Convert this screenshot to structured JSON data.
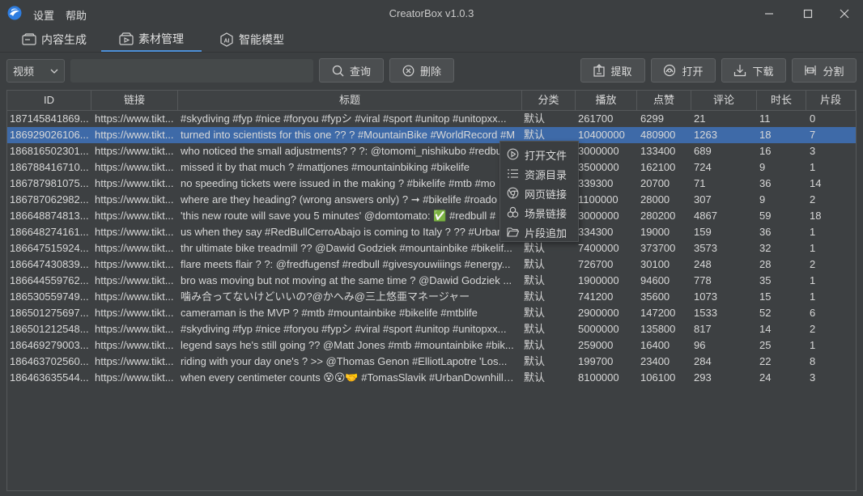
{
  "app": {
    "title": "CreatorBox v1.0.3"
  },
  "menu": {
    "settings": "设置",
    "help": "帮助"
  },
  "tabs": [
    {
      "label": "内容生成",
      "icon": "content-generate-icon"
    },
    {
      "label": "素材管理",
      "icon": "material-manage-icon",
      "active": true
    },
    {
      "label": "智能模型",
      "icon": "ai-model-icon"
    }
  ],
  "toolbar": {
    "type_select": "视频",
    "search_value": "",
    "query": "查询",
    "delete": "删除",
    "extract": "提取",
    "open": "打开",
    "download": "下载",
    "split": "分割"
  },
  "table": {
    "columns": [
      "ID",
      "链接",
      "标题",
      "分类",
      "播放",
      "点赞",
      "评论",
      "时长",
      "片段"
    ],
    "rows": [
      [
        "187145841869...",
        "https://www.tikt...",
        "#skydiving #fyp #nice #foryou #fypシ #viral #sport #unitop #unitopxx...",
        "默认",
        "261700",
        "6299",
        "21",
        "11",
        "0"
      ],
      [
        "186929026106...",
        "https://www.tikt...",
        "turned into scientists for this one ?? ? #MountainBike #WorldRecord #M",
        "默认",
        "10400000",
        "480900",
        "1263",
        "18",
        "7"
      ],
      [
        "186816502301...",
        "https://www.tikt...",
        "who noticed the small adjustments? ? ?: @tomomi_nishikubo #redbu",
        "默认",
        "3000000",
        "133400",
        "689",
        "16",
        "3"
      ],
      [
        "186788416710...",
        "https://www.tikt...",
        "missed it by that much ? #mattjones #mountainbiking #bikelife",
        "默认",
        "3500000",
        "162100",
        "724",
        "9",
        "1"
      ],
      [
        "186787981075...",
        "https://www.tikt...",
        "no speeding tickets were issued in the making ? #bikelife #mtb #mo",
        "默认",
        "339300",
        "20700",
        "71",
        "36",
        "14"
      ],
      [
        "186787062982...",
        "https://www.tikt...",
        "where are they heading? (wrong answers only) ? ➞ #bikelife #roado",
        "默认",
        "1100000",
        "28000",
        "307",
        "9",
        "2"
      ],
      [
        "186648874813...",
        "https://www.tikt...",
        "'this new route will save you 5 minutes' @domtomato: ✅ #redbull #",
        "默认",
        "3000000",
        "280200",
        "4867",
        "59",
        "18"
      ],
      [
        "186648274161...",
        "https://www.tikt...",
        "us when they say #RedBullCerroAbajo is coming to Italy ? ?? #Urban",
        "默认",
        "334300",
        "19000",
        "159",
        "36",
        "1"
      ],
      [
        "186647515924...",
        "https://www.tikt...",
        "thr ultimate bike treadmill ?? @Dawid Godziek #mountainbike #bikelif...",
        "默认",
        "7400000",
        "373700",
        "3573",
        "32",
        "1"
      ],
      [
        "186647430839...",
        "https://www.tikt...",
        "flare meets flair ? ?: @fredfugensf #redbull #givesyouwiiings #energy...",
        "默认",
        "726700",
        "30100",
        "248",
        "28",
        "2"
      ],
      [
        "186644559762...",
        "https://www.tikt...",
        "bro was moving but not moving at the same time ? @Dawid Godziek ...",
        "默认",
        "1900000",
        "94600",
        "778",
        "35",
        "1"
      ],
      [
        "186530559749...",
        "https://www.tikt...",
        "噛み合ってないけどいいの?@かへみ@三上悠亜マネージャー",
        "默认",
        "741200",
        "35600",
        "1073",
        "15",
        "1"
      ],
      [
        "186501275697...",
        "https://www.tikt...",
        "cameraman is the MVP ? #mtb #mountainbike #bikelife #mtblife",
        "默认",
        "2900000",
        "147200",
        "1533",
        "52",
        "6"
      ],
      [
        "186501212548...",
        "https://www.tikt...",
        "#skydiving #fyp #nice #foryou #fypシ #viral #sport #unitop #unitopxx...",
        "默认",
        "5000000",
        "135800",
        "817",
        "14",
        "2"
      ],
      [
        "186469279003...",
        "https://www.tikt...",
        "legend says he's still going ?? @Matt Jones #mtb #mountainbike #bik...",
        "默认",
        "259000",
        "16400",
        "96",
        "25",
        "1"
      ],
      [
        "186463702560...",
        "https://www.tikt...",
        "riding with your day one's ? >>  @Thomas Genon #ElliotLapotre  'Los...",
        "默认",
        "199700",
        "23400",
        "284",
        "22",
        "8"
      ],
      [
        "186463635544...",
        "https://www.tikt...",
        "when every centimeter counts 😵😮🤝 #TomasSlavik #UrbanDownhillMTB",
        "默认",
        "8100000",
        "106100",
        "293",
        "24",
        "3"
      ]
    ],
    "selected_row": 1
  },
  "context_menu": [
    {
      "label": "打开文件",
      "icon": "play-circle-icon"
    },
    {
      "label": "资源目录",
      "icon": "list-icon"
    },
    {
      "label": "网页链接",
      "icon": "chrome-icon"
    },
    {
      "label": "场景链接",
      "icon": "scene-link-icon"
    },
    {
      "label": "片段追加",
      "icon": "folder-open-icon"
    }
  ],
  "colors": {
    "accent": "#4d90d8",
    "selection": "#3e6aa8",
    "background": "#3c3f41"
  }
}
